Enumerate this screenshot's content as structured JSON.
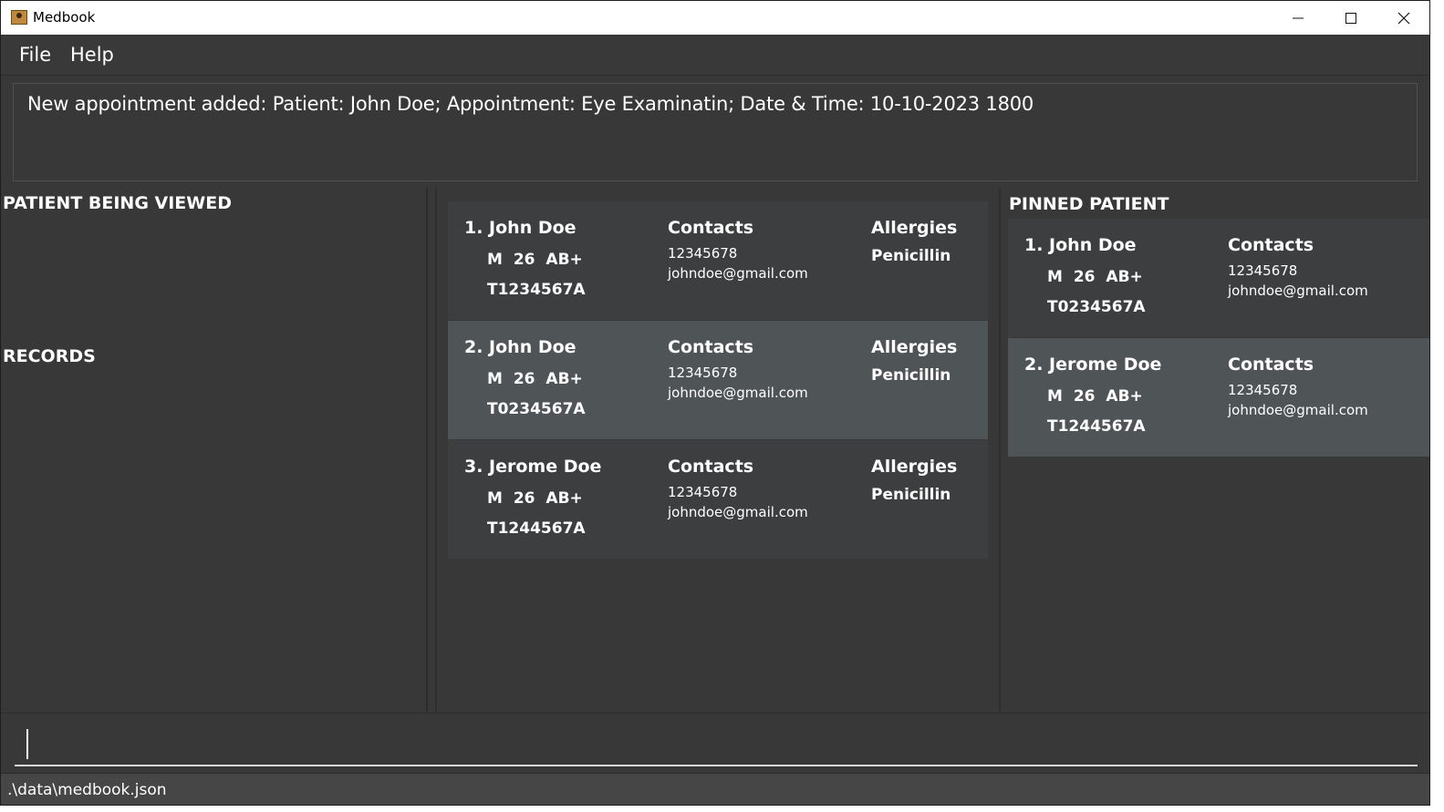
{
  "window": {
    "title": "Medbook"
  },
  "menu": {
    "file_label": "File",
    "help_label": "Help"
  },
  "result": {
    "message": "New appointment added: Patient: John Doe; Appointment: Eye Examinatin; Date & Time: 10-10-2023 1800"
  },
  "left_panel": {
    "viewed_heading": "PATIENT BEING VIEWED",
    "records_heading": "RECORDS"
  },
  "patients": [
    {
      "index_name": "1. John Doe",
      "meta": "M 26 AB+",
      "nric": "T1234567A",
      "contacts_heading": "Contacts",
      "phone": "12345678",
      "email": "johndoe@gmail.com",
      "allergies_heading": "Allergies",
      "allergy": "Penicillin"
    },
    {
      "index_name": "2. John Doe",
      "meta": "M 26 AB+",
      "nric": "T0234567A",
      "contacts_heading": "Contacts",
      "phone": "12345678",
      "email": "johndoe@gmail.com",
      "allergies_heading": "Allergies",
      "allergy": "Penicillin"
    },
    {
      "index_name": "3. Jerome Doe",
      "meta": "M 26 AB+",
      "nric": "T1244567A",
      "contacts_heading": "Contacts",
      "phone": "12345678",
      "email": "johndoe@gmail.com",
      "allergies_heading": "Allergies",
      "allergy": "Penicillin"
    }
  ],
  "pinned": {
    "heading": "PINNED PATIENT",
    "patients": [
      {
        "index_name": "1. John Doe",
        "meta": "M 26 AB+",
        "nric": "T0234567A",
        "contacts_heading": "Contacts",
        "phone": "12345678",
        "email": "johndoe@gmail.com"
      },
      {
        "index_name": "2. Jerome Doe",
        "meta": "M 26 AB+",
        "nric": "T1244567A",
        "contacts_heading": "Contacts",
        "phone": "12345678",
        "email": "johndoe@gmail.com"
      }
    ]
  },
  "command": {
    "value": ""
  },
  "status": {
    "file_path": ".\\data\\medbook.json"
  },
  "colors": {
    "background": "#383838",
    "card_dark": "#3c3e3f",
    "card_selected": "#4f5457",
    "text": "#ffffff",
    "status_bar": "#464646"
  },
  "icons": {
    "app": "app-icon",
    "minimize": "minimize-icon",
    "maximize": "maximize-icon",
    "close": "close-icon"
  }
}
